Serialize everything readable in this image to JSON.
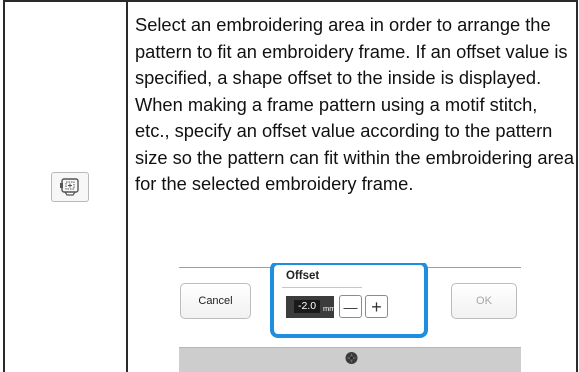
{
  "row": {
    "icon": "embroidery-frame-offset-icon",
    "description": "Select an embroidering area in order to arrange the pattern to fit an embroidery frame. If an offset value is specified, a shape offset to the inside is displayed. When making a frame pattern using a motif stitch, etc., specify an offset value according to the pattern size so the pattern can fit within the embroidering area for the selected embroidery frame."
  },
  "screen": {
    "cancel_label": "Cancel",
    "ok_label": "OK",
    "offset_label": "Offset",
    "offset_value": "-2.0",
    "offset_unit": "mm",
    "minus_label": "—",
    "plus_label": "+",
    "highlight_color": "#1e8fe0",
    "knob_icon": "dial-knob-icon"
  }
}
